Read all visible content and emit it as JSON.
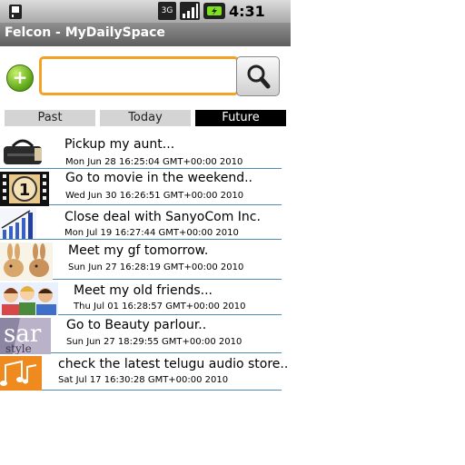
{
  "status_bar": {
    "network": "3G",
    "time": "4:31 PM"
  },
  "app": {
    "title": "Felcon - MyDailySpace"
  },
  "search": {
    "value": "",
    "placeholder": ""
  },
  "tabs": [
    {
      "label": "Past",
      "active": false
    },
    {
      "label": "Today",
      "active": false
    },
    {
      "label": "Future",
      "active": true
    }
  ],
  "items": [
    {
      "title": "Pickup my aunt...",
      "date": "Mon Jun 28 16:25:04 GMT+00:00 2010",
      "icon": "handbag-thumbnail"
    },
    {
      "title": "Go to movie in the weekend..",
      "date": "Wed Jun 30 16:26:51 GMT+00:00 2010",
      "icon": "film-countdown-thumbnail"
    },
    {
      "title": "Close deal with SanyoCom Inc.",
      "date": "Mon Jul 19 16:27:44 GMT+00:00 2010",
      "icon": "rising-bar-chart-thumbnail"
    },
    {
      "title": "Meet my gf tomorrow.",
      "date": "Sun Jun 27 16:28:19 GMT+00:00 2010",
      "icon": "bunnies-thumbnail"
    },
    {
      "title": "Meet my old friends...",
      "date": "Thu Jul 01 16:28:57 GMT+00:00 2010",
      "icon": "friends-cartoon-thumbnail"
    },
    {
      "title": "Go to Beauty parlour..",
      "date": "Sun Jun 27 18:29:55 GMT+00:00 2010",
      "icon": "star-style-magazine-thumbnail"
    },
    {
      "title": "check the latest telugu audio store..",
      "date": "Sat Jul 17 16:30:28 GMT+00:00 2010",
      "icon": "music-notes-thumbnail"
    }
  ]
}
